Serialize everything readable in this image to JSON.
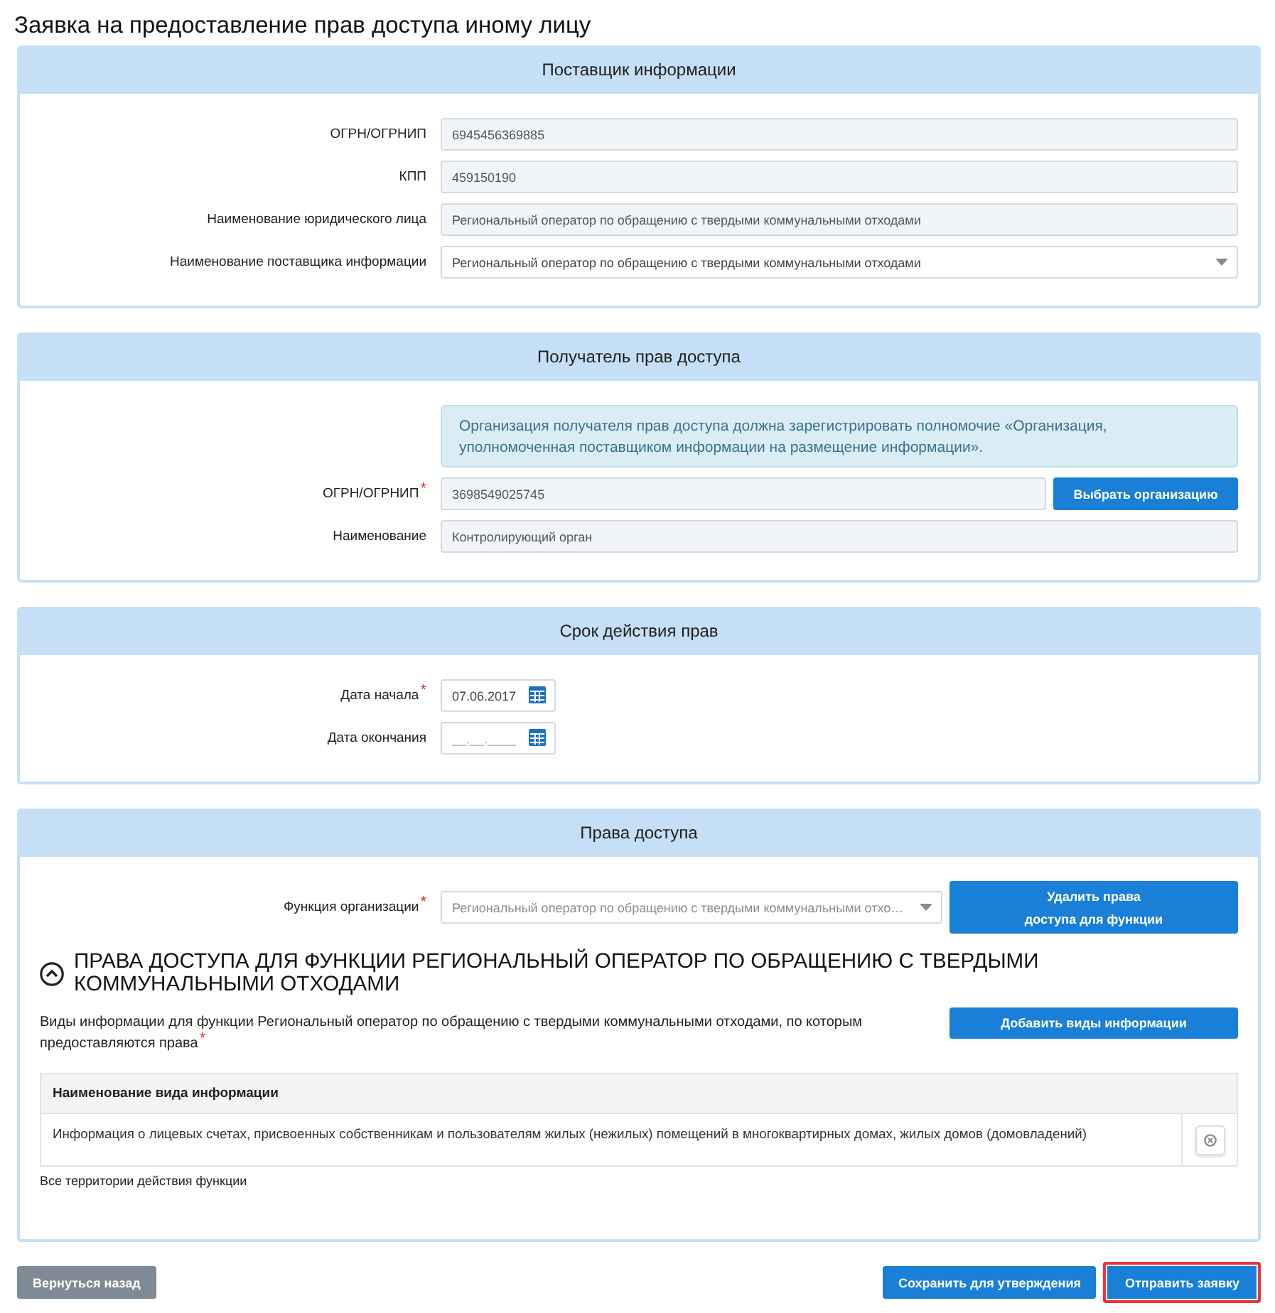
{
  "page": {
    "title": "Заявка на предоставление прав доступа иному лицу"
  },
  "sections": [
    {
      "title": "Поставщик информации",
      "fields": [
        {
          "kind": "text",
          "label": "ОГРН/ОГРНИП",
          "value": "6945456369885"
        },
        {
          "kind": "text",
          "label": "КПП",
          "value": "459150190"
        },
        {
          "kind": "text",
          "label": "Наименование юридического лица",
          "value": "Региональный оператор по обращению с твердыми коммунальными отходами"
        },
        {
          "kind": "select",
          "label": "Наименование поставщика информации",
          "value": "Региональный оператор по обращению с твердыми коммунальными отходами",
          "disabled": false
        }
      ]
    },
    {
      "title": "Получатель прав доступа",
      "notice": "Организация получателя прав доступа должна зарегистрировать полномочие «Организация, уполномоченная поставщиком информации на размещение информации».",
      "fields": [
        {
          "kind": "text",
          "label": "ОГРН/ОГРНИП$^{*}$",
          "value": "3698549025745",
          "button": {
            "kind": "choose",
            "label": "Выбрать организацию"
          }
        },
        {
          "kind": "text",
          "label": "Наименование",
          "value": "Контролирующий орган"
        }
      ]
    },
    {
      "title": "Срок действия прав",
      "fields": [
        {
          "kind": "date",
          "label": "Дата начала$^{*}$",
          "value": "07.06.2017"
        },
        {
          "kind": "date",
          "label": "Дата окончания",
          "placeholder": "__.__.____"
        }
      ]
    },
    {
      "title": "Права доступа",
      "fields": [
        {
          "kind": "select",
          "label": "Функция организации$^{*}$",
          "value": "Региональный оператор по обращению с твердыми коммунальными отхо…",
          "disabled": true,
          "button": {
            "kind": "remove",
            "label": "Удалить права доступа для функции"
          }
        }
      ],
      "group": {
        "title": "ПРАВА ДОСТУПА ДЛЯ ФУНКЦИИ РЕГИОНАЛЬНЫЙ ОПЕРАТОР ПО ОБРАЩЕНИЮ С ТВЕРДЫМИ КОММУНАЛЬНЫМИ ОТХОДАМИ",
        "expanded": true,
        "description": "Виды информации для функции Региональный оператор по обращению с твердыми коммунальными отходами, по которым предоставляются права$^{*}$",
        "add_button": "Добавить виды информации",
        "table": {
          "columns": [
            "Наименование вида информации"
          ],
          "rows": [
            {
              "cells": [
                "Информация о лицевых счетах, присвоенных собственникам и пользователям жилых (нежилых) помещений в многоквартирных домах, жилых домов (домовладений)"
              ]
            }
          ]
        },
        "note": "Все территории действия функции"
      }
    }
  ],
  "actions": [
    {
      "kind": "back",
      "label": "Вернуться назад",
      "highlighted": false
    },
    {
      "kind": "save",
      "label": "Сохранить для утверждения",
      "highlighted": false
    },
    {
      "kind": "submit",
      "label": "Отправить заявку",
      "highlighted": true
    }
  ]
}
